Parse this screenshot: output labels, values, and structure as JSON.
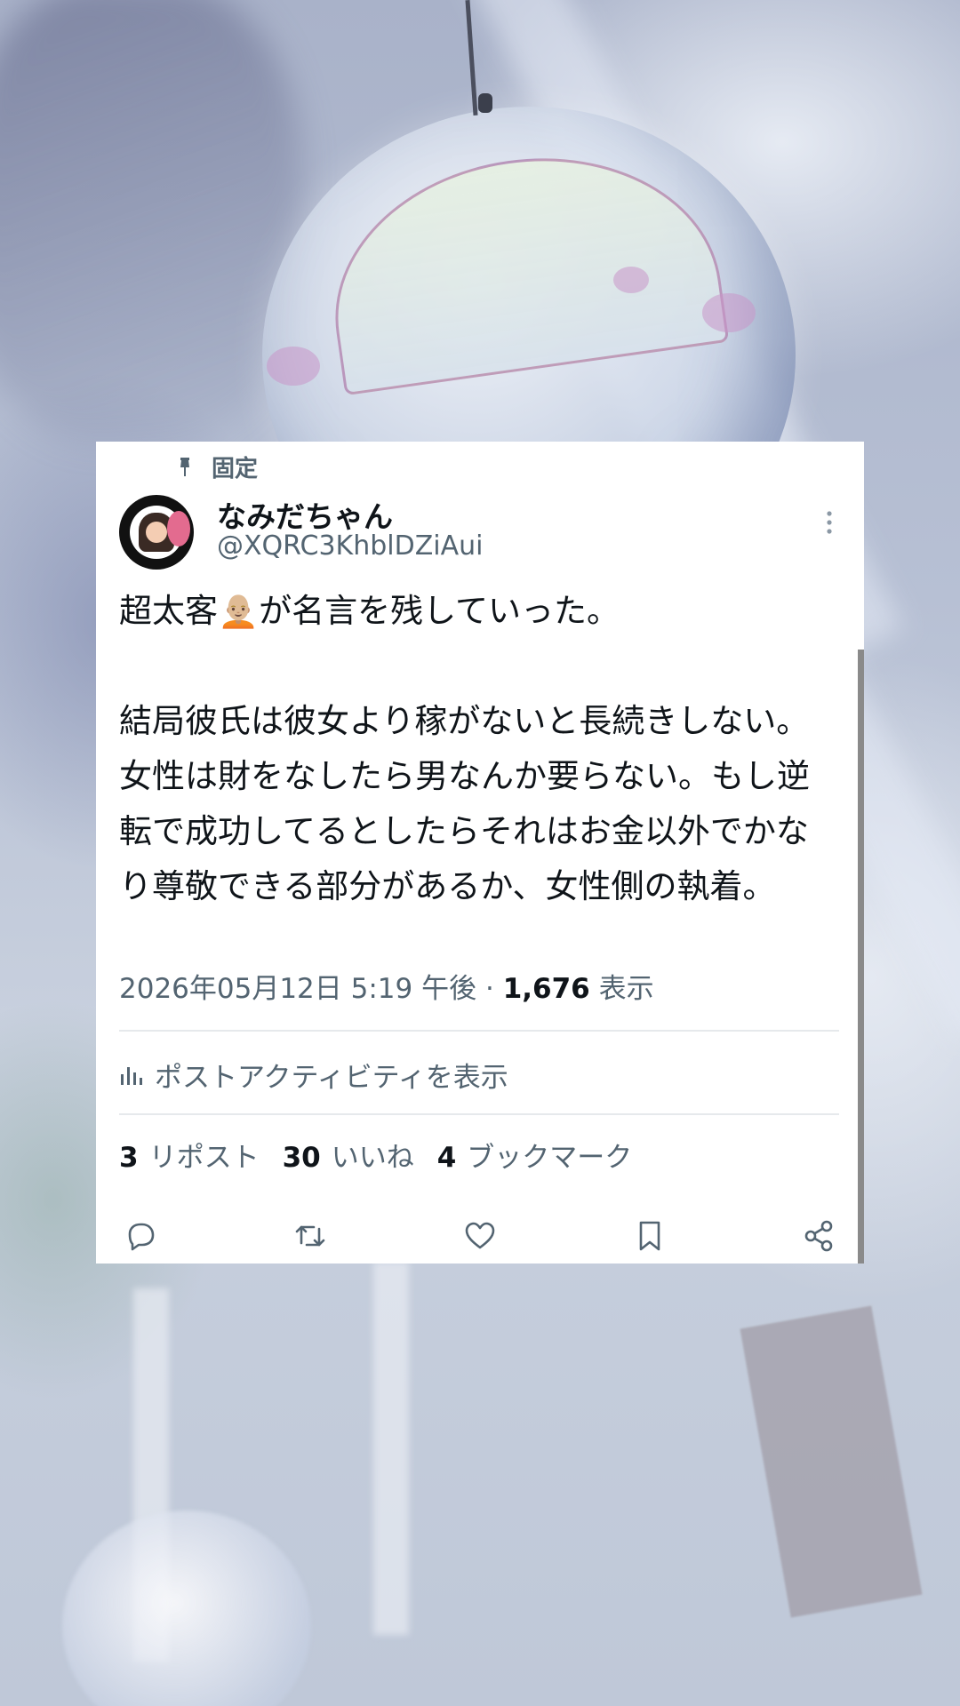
{
  "post": {
    "pinned_label": "固定",
    "author": {
      "display_name": "なみだちゃん",
      "handle": "@XQRC3KhblDZiAui"
    },
    "text": "超太客🧑🏼‍🦲が名言を残していった。\n\n結局彼氏は彼女より稼がないと長続きしない。女性は財をなしたら男なんか要らない。もし逆転で成功してるとしたらそれはお金以外でかなり尊敬できる部分があるか、女性側の執着。",
    "timestamp": "2026年05月12日 5:19 午後",
    "separator": "·",
    "views_count": "1,676",
    "views_label": "表示",
    "activity_label": "ポストアクティビティを表示",
    "stats": {
      "reposts_count": "3",
      "reposts_label": "リポスト",
      "likes_count": "30",
      "likes_label": "いいね",
      "bookmarks_count": "4",
      "bookmarks_label": "ブックマーク"
    }
  },
  "icons": [
    "pin-icon",
    "more-options-icon",
    "analytics-icon",
    "reply-icon",
    "repost-icon",
    "like-icon",
    "bookmark-icon",
    "share-icon"
  ],
  "colors": {
    "text_primary": "#0f1419",
    "text_secondary": "#536471",
    "divider": "#e6e9ec",
    "card_background": "#ffffff"
  }
}
